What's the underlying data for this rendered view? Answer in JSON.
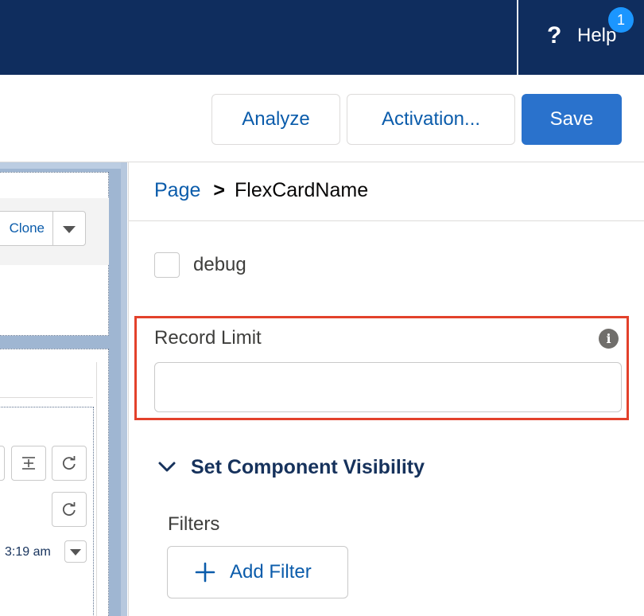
{
  "header": {
    "help_icon": "question-icon",
    "help_label": "Help",
    "help_badge": "1"
  },
  "toolbar": {
    "analyze_label": "Analyze",
    "activation_label": "Activation...",
    "save_label": "Save"
  },
  "canvas": {
    "clone_label": "Clone",
    "time_text": "3:19 am",
    "icons": [
      "expand-icon",
      "refresh-icon",
      "refresh-icon",
      "chevron-down-icon"
    ]
  },
  "panel": {
    "breadcrumb": {
      "parent": "Page",
      "separator": ">",
      "current": "FlexCardName"
    },
    "debug_label": "debug",
    "debug_checked": false,
    "record_limit": {
      "label": "Record Limit",
      "value": "",
      "info_icon": "info-icon"
    },
    "visibility": {
      "title": "Set Component Visibility",
      "expanded": true,
      "filters_label": "Filters",
      "add_filter_label": "Add Filter"
    }
  },
  "colors": {
    "header_bg": "#0f2d5e",
    "brand": "#2a72cc",
    "link": "#0b5cab",
    "highlight": "#e3412b",
    "badge": "#1b96ff"
  }
}
